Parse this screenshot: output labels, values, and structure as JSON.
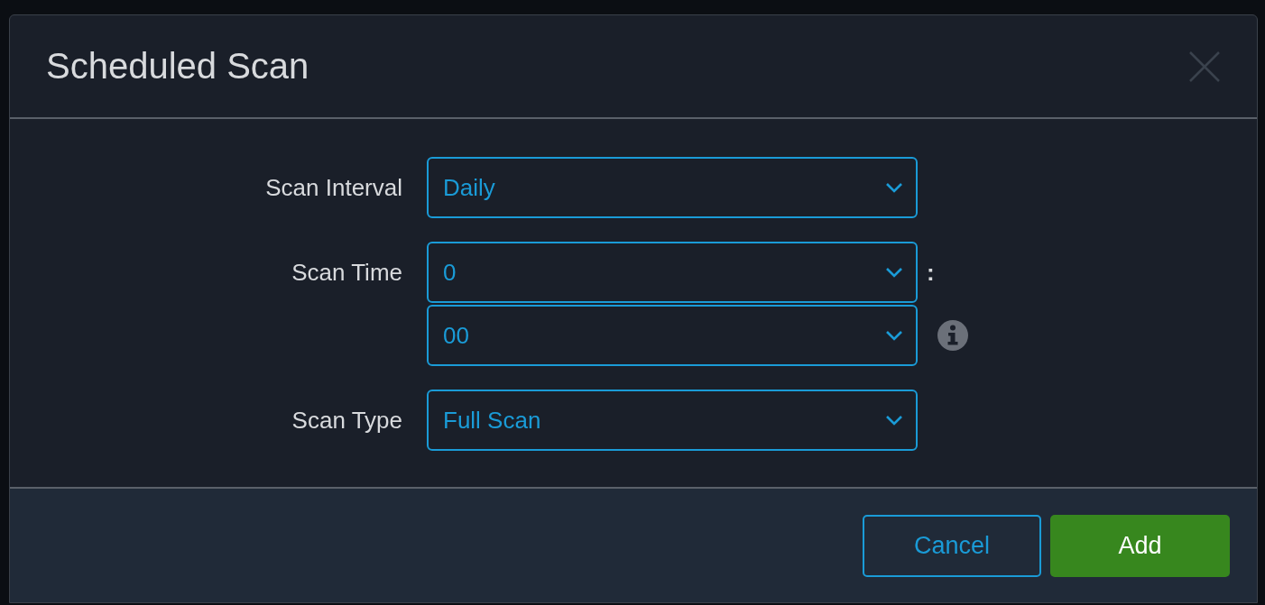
{
  "dialog": {
    "title": "Scheduled Scan"
  },
  "fields": [
    {
      "label": "Scan Interval",
      "selects": [
        {
          "value": "Daily"
        }
      ]
    },
    {
      "label": "Scan Time",
      "selects": [
        {
          "value": "0",
          "suffix": ":"
        },
        {
          "value": "00",
          "info": true
        }
      ]
    },
    {
      "label": "Scan Type",
      "selects": [
        {
          "value": "Full Scan"
        }
      ]
    }
  ],
  "buttons": [
    {
      "label": "Cancel",
      "kind": "secondary"
    },
    {
      "label": "Add",
      "kind": "primary"
    }
  ]
}
